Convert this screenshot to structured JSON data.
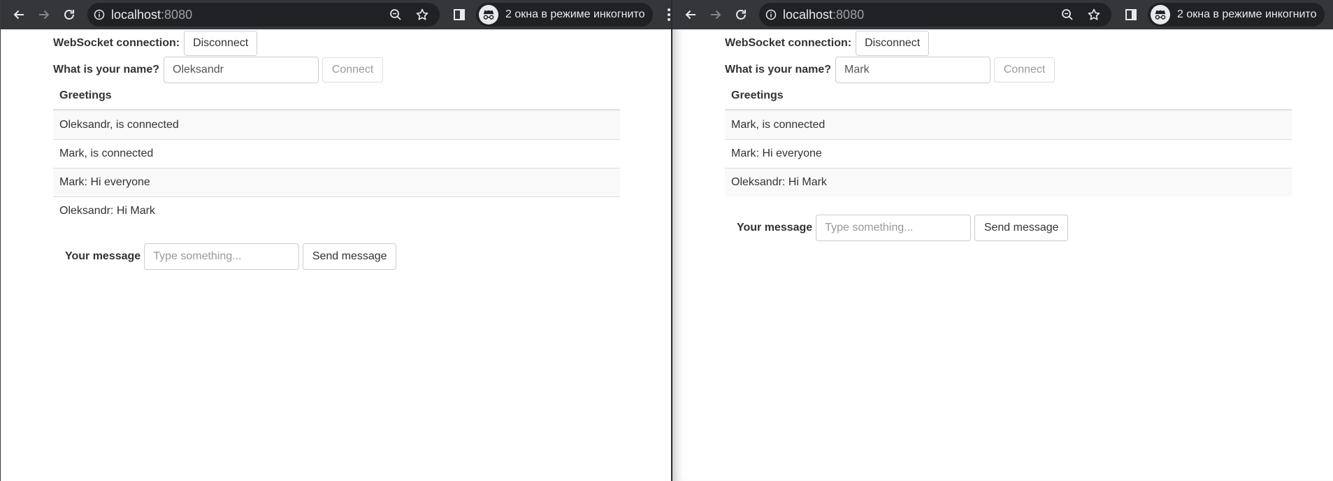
{
  "browser": {
    "url_host": "localhost",
    "url_port": ":8080",
    "incognito_label": "2 окна в режиме инкогнито"
  },
  "icons": [
    "back-arrow-icon",
    "forward-arrow-icon",
    "reload-icon",
    "site-info-icon",
    "zoom-icon",
    "bookmark-star-icon",
    "side-panel-icon",
    "incognito-icon",
    "more-menu-icon"
  ],
  "colors": {
    "toolbar": "#35363a",
    "omnibox": "#202124",
    "striped_row": "#f9f9f9",
    "border": "#cccccc"
  },
  "left_window": {
    "ws_label": "WebSocket connection:",
    "disconnect_label": "Disconnect",
    "name_label": "What is your name?",
    "name_value": "Oleksandr",
    "connect_label": "Connect",
    "table_header": "Greetings",
    "rows": [
      "Oleksandr, is connected",
      "Mark, is connected",
      "Mark: Hi everyone",
      "Oleksandr: Hi Mark"
    ],
    "message_label": "Your message",
    "message_placeholder": "Type something...",
    "send_label": "Send message"
  },
  "right_window": {
    "ws_label": "WebSocket connection:",
    "disconnect_label": "Disconnect",
    "name_label": "What is your name?",
    "name_value": "Mark",
    "connect_label": "Connect",
    "table_header": "Greetings",
    "rows": [
      "Mark, is connected",
      "Mark: Hi everyone",
      "Oleksandr: Hi Mark"
    ],
    "message_label": "Your message",
    "message_placeholder": "Type something...",
    "send_label": "Send message"
  }
}
